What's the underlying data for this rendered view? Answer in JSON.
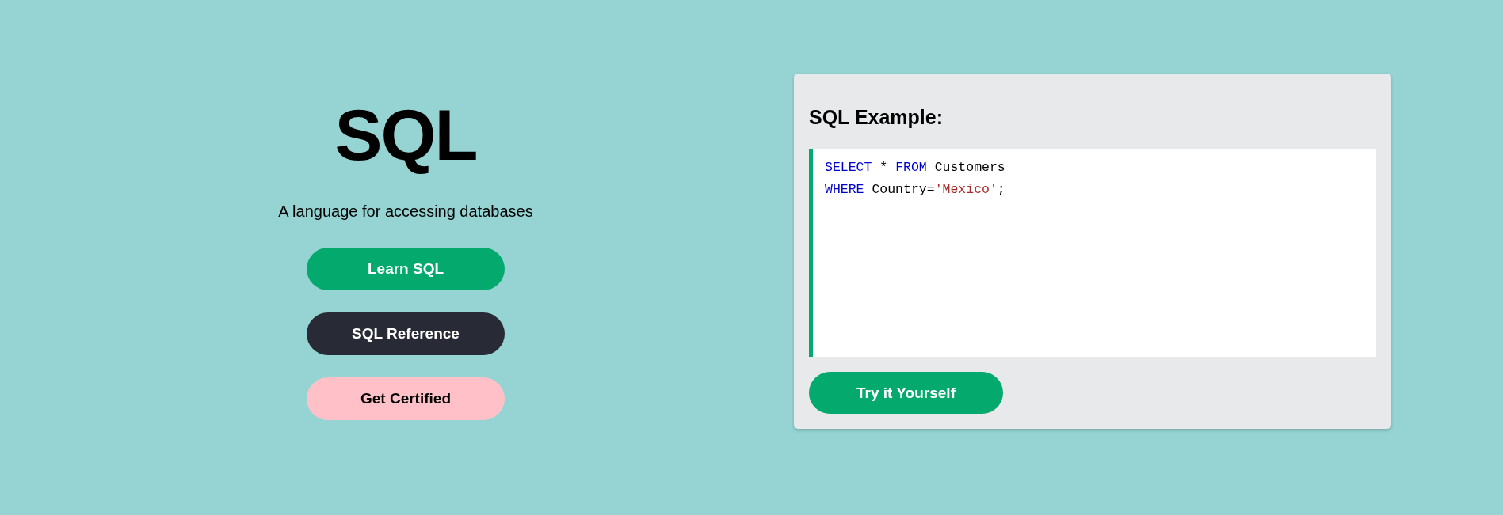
{
  "hero": {
    "title": "SQL",
    "subtitle": "A language for accessing databases",
    "buttons": [
      {
        "label": "Learn SQL",
        "kind": "primary"
      },
      {
        "label": "SQL Reference",
        "kind": "dark"
      },
      {
        "label": "Get Certified",
        "kind": "pink"
      }
    ]
  },
  "example": {
    "title": "SQL Example:",
    "code_lines": [
      [
        {
          "text": "SELECT",
          "kind": "keyword"
        },
        {
          "text": " * ",
          "kind": "plain"
        },
        {
          "text": "FROM",
          "kind": "keyword"
        },
        {
          "text": " Customers",
          "kind": "plain"
        }
      ],
      [
        {
          "text": "WHERE",
          "kind": "keyword"
        },
        {
          "text": " Country=",
          "kind": "plain"
        },
        {
          "text": "'Mexico'",
          "kind": "string"
        },
        {
          "text": ";",
          "kind": "plain"
        }
      ]
    ],
    "button": {
      "label": "Try it Yourself",
      "kind": "primary"
    }
  }
}
